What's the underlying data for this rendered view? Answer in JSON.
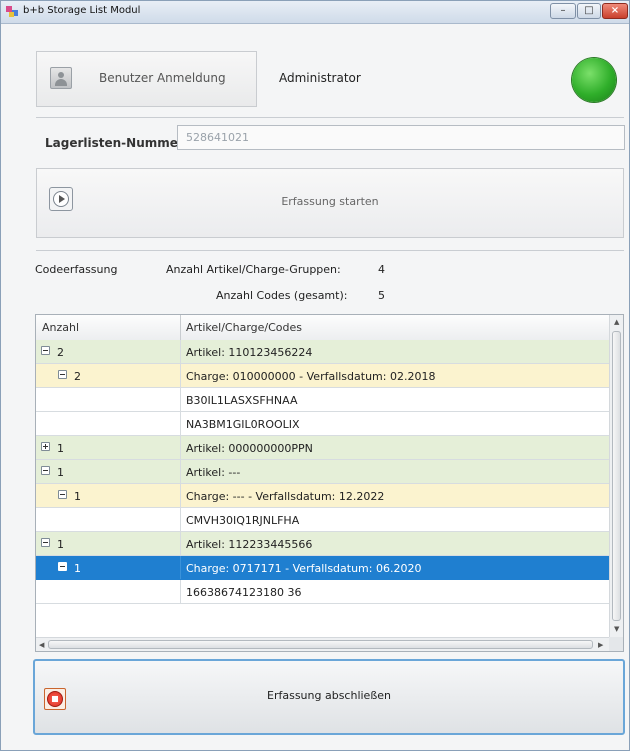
{
  "window": {
    "title": "b+b Storage List Modul"
  },
  "colors": {
    "accent": "#1f7fd0",
    "artikel_row": "#e5efd8",
    "charge_row": "#fbf3cf",
    "status_ok": "#2fae2a"
  },
  "login": {
    "button_label": "Benutzer Anmeldung",
    "user": "Administrator"
  },
  "lagerliste": {
    "label": "Lagerlisten-Nummer:",
    "value": "528641021"
  },
  "start": {
    "label": "Erfassung starten"
  },
  "stats": {
    "section_label": "Codeerfassung",
    "groups_label": "Anzahl Artikel/Charge-Gruppen:",
    "groups_value": "4",
    "codes_label": "Anzahl Codes (gesamt):",
    "codes_value": "5"
  },
  "grid": {
    "headers": {
      "count": "Anzahl",
      "detail": "Artikel/Charge/Codes"
    },
    "rows": [
      {
        "type": "artikel",
        "expander": "minus",
        "count": "2",
        "text": "Artikel: 110123456224"
      },
      {
        "type": "charge",
        "expander": "minus",
        "count": "2",
        "text": "Charge: 010000000  -  Verfallsdatum: 02.2018"
      },
      {
        "type": "code",
        "expander": "",
        "count": "",
        "text": "B30IL1LASXSFHNAA"
      },
      {
        "type": "code",
        "expander": "",
        "count": "",
        "text": "NA3BM1GIL0ROOLIX"
      },
      {
        "type": "artikel",
        "expander": "plus",
        "count": "1",
        "text": "Artikel: 000000000PPN"
      },
      {
        "type": "artikel",
        "expander": "minus",
        "count": "1",
        "text": "Artikel: ---"
      },
      {
        "type": "charge",
        "expander": "minus",
        "count": "1",
        "text": "Charge: ---  -  Verfallsdatum: 12.2022"
      },
      {
        "type": "code",
        "expander": "",
        "count": "",
        "text": "CMVH30IQ1RJNLFHA"
      },
      {
        "type": "artikel",
        "expander": "minus",
        "count": "1",
        "text": "Artikel: 112233445566"
      },
      {
        "type": "selected",
        "expander": "minus",
        "count": "1",
        "text": "Charge: 0717171  -  Verfallsdatum: 06.2020"
      },
      {
        "type": "code",
        "expander": "",
        "count": "",
        "text": "16638674123180 36"
      }
    ]
  },
  "finish": {
    "label": "Erfassung abschließen"
  }
}
